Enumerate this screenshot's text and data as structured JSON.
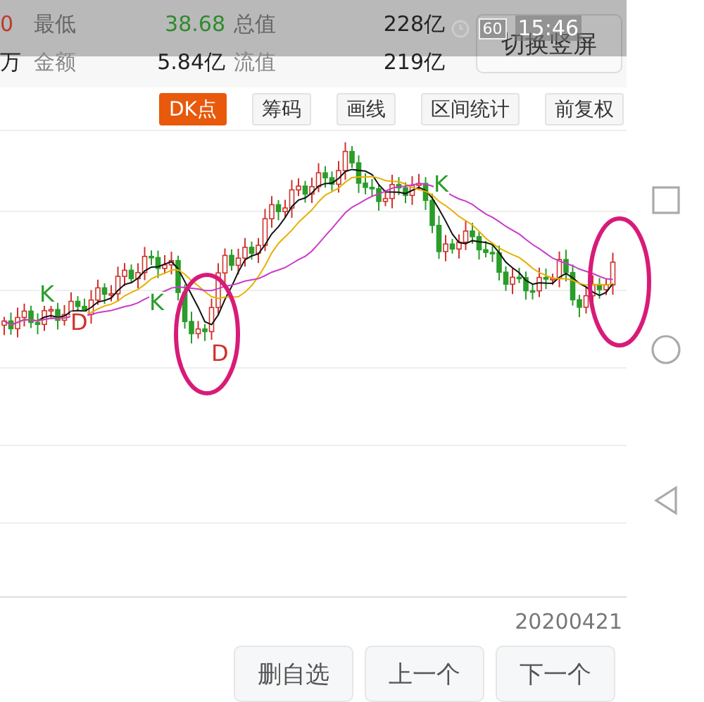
{
  "status_bar": {
    "battery": "60",
    "time": "15:46"
  },
  "stats": [
    [
      {
        "text": "0",
        "color": "#c0392b"
      },
      {
        "text": "最低",
        "color": "#666666"
      },
      {
        "text": "38.68",
        "color": "#2e8b2e"
      },
      {
        "text": "总值",
        "color": "#666666"
      },
      {
        "text": "228亿",
        "color": "#222222"
      }
    ],
    [
      {
        "text": "万",
        "color": "#222222"
      },
      {
        "text": "金额",
        "color": "#888888"
      },
      {
        "text": "5.84亿",
        "color": "#222222"
      },
      {
        "text": "流值",
        "color": "#888888"
      },
      {
        "text": "219亿",
        "color": "#222222"
      }
    ]
  ],
  "orientation_button": "切换竖屏",
  "tools": [
    {
      "label": "DK点",
      "selected": true
    },
    {
      "label": "筹码",
      "selected": false
    },
    {
      "label": "画线",
      "selected": false
    },
    {
      "label": "区间统计",
      "selected": false
    },
    {
      "label": "前复权",
      "selected": false
    }
  ],
  "chart": {
    "markers": [
      {
        "label": "K",
        "kind": "k"
      },
      {
        "label": "D",
        "kind": "d"
      },
      {
        "label": "K",
        "kind": "k"
      },
      {
        "label": "D",
        "kind": "d"
      },
      {
        "label": "K",
        "kind": "k"
      }
    ]
  },
  "date": "20200421",
  "actions": [
    "删自选",
    "上一个",
    "下一个"
  ]
}
